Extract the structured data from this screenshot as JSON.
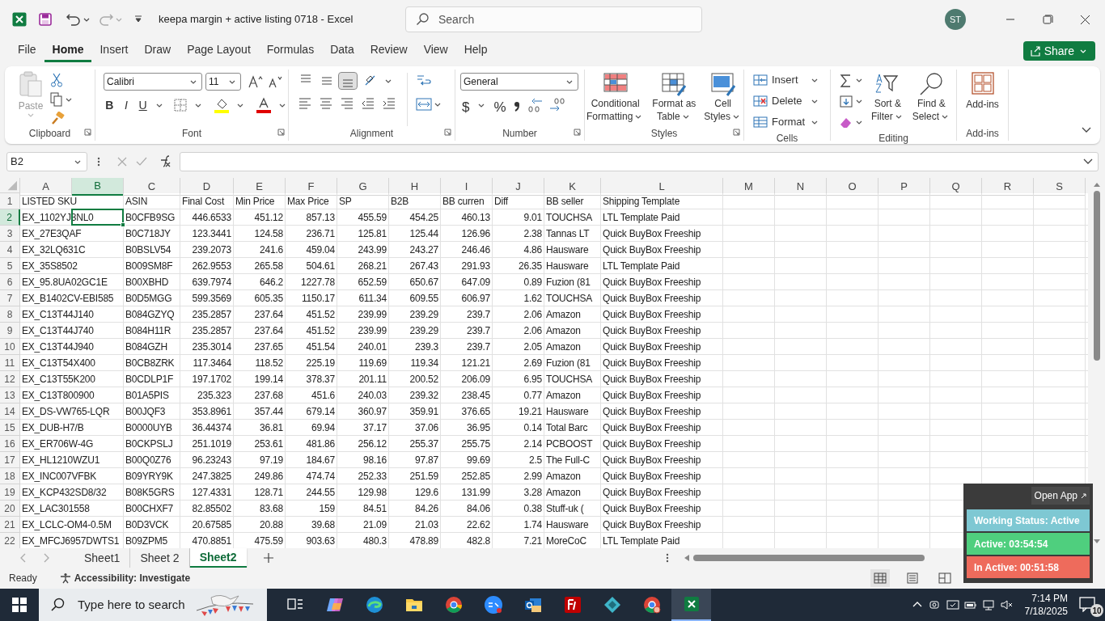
{
  "window": {
    "title": "keepa margin + active listing 0718  -  Excel",
    "search_placeholder": "Search",
    "avatar": "ST"
  },
  "menu_tabs": [
    {
      "label": "File",
      "selected": false
    },
    {
      "label": "Home",
      "selected": true
    },
    {
      "label": "Insert",
      "selected": false
    },
    {
      "label": "Draw",
      "selected": false
    },
    {
      "label": "Page Layout",
      "selected": false
    },
    {
      "label": "Formulas",
      "selected": false
    },
    {
      "label": "Data",
      "selected": false
    },
    {
      "label": "Review",
      "selected": false
    },
    {
      "label": "View",
      "selected": false
    },
    {
      "label": "Help",
      "selected": false
    }
  ],
  "share": "Share",
  "ribbon": {
    "clipboard": {
      "paste": "Paste",
      "label": "Clipboard"
    },
    "font": {
      "name": "Calibri",
      "size": "11",
      "styles": [
        "B",
        "I",
        "U"
      ],
      "label": "Font"
    },
    "alignment": {
      "vertical": [
        {
          "selected": false
        },
        {
          "selected": false
        },
        {
          "selected": true
        }
      ],
      "label": "Alignment"
    },
    "number": {
      "format": "General",
      "symbols": [
        "$",
        "%"
      ],
      "label": "Number"
    },
    "styles": {
      "buttons": [
        {
          "lines": [
            "Conditional",
            "Formatting"
          ]
        },
        {
          "lines": [
            "Format as",
            "Table"
          ]
        },
        {
          "lines": [
            "Cell",
            "Styles"
          ]
        }
      ],
      "label": "Styles"
    },
    "cells": {
      "buttons": [
        "Insert",
        "Delete",
        "Format"
      ],
      "label": "Cells"
    },
    "editing": {
      "buttons": [
        {
          "lines": [
            "Sort &",
            "Filter"
          ]
        },
        {
          "lines": [
            "Find &",
            "Select"
          ]
        }
      ],
      "label": "Editing"
    },
    "addins": {
      "button": "Add-ins",
      "label": "Add-ins"
    }
  },
  "name_box": "B2",
  "sheet": {
    "columns": [
      {
        "label": "A",
        "kind": "text",
        "selected": false
      },
      {
        "label": "B",
        "selected": true
      },
      {
        "label": "C",
        "kind": "text",
        "selected": false
      },
      {
        "label": "D",
        "kind": "number",
        "selected": false
      },
      {
        "label": "E",
        "kind": "number",
        "selected": false
      },
      {
        "label": "F",
        "kind": "number",
        "selected": false
      },
      {
        "label": "G",
        "kind": "number",
        "selected": false
      },
      {
        "label": "H",
        "kind": "number",
        "selected": false
      },
      {
        "label": "I",
        "kind": "number",
        "selected": false
      },
      {
        "label": "J",
        "kind": "number",
        "selected": false
      },
      {
        "label": "K",
        "kind": "text",
        "selected": false
      },
      {
        "label": "L",
        "kind": "text",
        "selected": false
      },
      {
        "label": "M",
        "selected": false
      },
      {
        "label": "N",
        "selected": false
      },
      {
        "label": "O",
        "selected": false
      },
      {
        "label": "P",
        "selected": false
      },
      {
        "label": "Q",
        "selected": false
      },
      {
        "label": "R",
        "selected": false
      },
      {
        "label": "S",
        "selected": false
      }
    ],
    "rows": [
      {
        "number": "1",
        "kind": "header",
        "selected": false,
        "cells": [
          "LISTED SKU",
          null,
          "ASIN",
          "Final Cost",
          "Min Price",
          "Max Price",
          "SP",
          "B2B",
          "BB curren",
          "Diff",
          "BB seller",
          "Shipping Template"
        ]
      },
      {
        "number": "2",
        "kind": "data",
        "selected": true,
        "cells": [
          "EX_1102YJ3NL0",
          null,
          "B0CFB9SG",
          "446.6533",
          "451.12",
          "857.13",
          "455.59",
          "454.25",
          "460.13",
          "9.01",
          "TOUCHSA",
          "LTL Template Paid"
        ]
      },
      {
        "number": "3",
        "kind": "data",
        "selected": false,
        "cells": [
          "EX_27E3QAF",
          null,
          "B0C718JY",
          "123.3441",
          "124.58",
          "236.71",
          "125.81",
          "125.44",
          "126.96",
          "2.38",
          "Tannas LT",
          "Quick BuyBox Freeship"
        ]
      },
      {
        "number": "4",
        "kind": "data",
        "selected": false,
        "cells": [
          "EX_32LQ631C",
          null,
          "B0BSLV54",
          "239.2073",
          "241.6",
          "459.04",
          "243.99",
          "243.27",
          "246.46",
          "4.86",
          "Hausware",
          "Quick BuyBox Freeship"
        ]
      },
      {
        "number": "5",
        "kind": "data",
        "selected": false,
        "cells": [
          "EX_35S8502",
          null,
          "B009SM8F",
          "262.9553",
          "265.58",
          "504.61",
          "268.21",
          "267.43",
          "291.93",
          "26.35",
          "Hausware",
          "LTL Template Paid"
        ]
      },
      {
        "number": "6",
        "kind": "data",
        "selected": false,
        "cells": [
          "EX_95.8UA02GC1E",
          null,
          "B00XBHD",
          "639.7974",
          "646.2",
          "1227.78",
          "652.59",
          "650.67",
          "647.09",
          "0.89",
          "Fuzion (81",
          "Quick BuyBox Freeship"
        ]
      },
      {
        "number": "7",
        "kind": "data",
        "selected": false,
        "cells": [
          "EX_B1402CV-EBI585",
          null,
          "B0D5MGG",
          "599.3569",
          "605.35",
          "1150.17",
          "611.34",
          "609.55",
          "606.97",
          "1.62",
          "TOUCHSA",
          "Quick BuyBox Freeship"
        ]
      },
      {
        "number": "8",
        "kind": "data",
        "selected": false,
        "cells": [
          "EX_C13T44J140",
          null,
          "B084GZYQ",
          "235.2857",
          "237.64",
          "451.52",
          "239.99",
          "239.29",
          "239.7",
          "2.06",
          "Amazon",
          "Quick BuyBox Freeship"
        ]
      },
      {
        "number": "9",
        "kind": "data",
        "selected": false,
        "cells": [
          "EX_C13T44J740",
          null,
          "B084H11R",
          "235.2857",
          "237.64",
          "451.52",
          "239.99",
          "239.29",
          "239.7",
          "2.06",
          "Amazon",
          "Quick BuyBox Freeship"
        ]
      },
      {
        "number": "10",
        "kind": "data",
        "selected": false,
        "cells": [
          "EX_C13T44J940",
          null,
          "B084GZH",
          "235.3014",
          "237.65",
          "451.54",
          "240.01",
          "239.3",
          "239.7",
          "2.05",
          "Amazon",
          "Quick BuyBox Freeship"
        ]
      },
      {
        "number": "11",
        "kind": "data",
        "selected": false,
        "cells": [
          "EX_C13T54X400",
          null,
          "B0CB8ZRK",
          "117.3464",
          "118.52",
          "225.19",
          "119.69",
          "119.34",
          "121.21",
          "2.69",
          "Fuzion (81",
          "Quick BuyBox Freeship"
        ]
      },
      {
        "number": "12",
        "kind": "data",
        "selected": false,
        "cells": [
          "EX_C13T55K200",
          null,
          "B0CDLP1F",
          "197.1702",
          "199.14",
          "378.37",
          "201.11",
          "200.52",
          "206.09",
          "6.95",
          "TOUCHSA",
          "Quick BuyBox Freeship"
        ]
      },
      {
        "number": "13",
        "kind": "data",
        "selected": false,
        "cells": [
          "EX_C13T800900",
          null,
          "B01A5PIS",
          "235.323",
          "237.68",
          "451.6",
          "240.03",
          "239.32",
          "238.45",
          "0.77",
          "Amazon",
          "Quick BuyBox Freeship"
        ]
      },
      {
        "number": "14",
        "kind": "data",
        "selected": false,
        "cells": [
          "EX_DS-VW765-LQR",
          null,
          "B00JQF3",
          "353.8961",
          "357.44",
          "679.14",
          "360.97",
          "359.91",
          "376.65",
          "19.21",
          "Hausware",
          "Quick BuyBox Freeship"
        ]
      },
      {
        "number": "15",
        "kind": "data",
        "selected": false,
        "cells": [
          "EX_DUB-H7/B",
          null,
          "B0000UYB",
          "36.44374",
          "36.81",
          "69.94",
          "37.17",
          "37.06",
          "36.95",
          "0.14",
          "Total Barc",
          "Quick BuyBox Freeship"
        ]
      },
      {
        "number": "16",
        "kind": "data",
        "selected": false,
        "cells": [
          "EX_ER706W-4G",
          null,
          "B0CKPSLJ",
          "251.1019",
          "253.61",
          "481.86",
          "256.12",
          "255.37",
          "255.75",
          "2.14",
          "PCBOOST",
          "Quick BuyBox Freeship"
        ]
      },
      {
        "number": "17",
        "kind": "data",
        "selected": false,
        "cells": [
          "EX_HL1210WZU1",
          null,
          "B00Q0Z76",
          "96.23243",
          "97.19",
          "184.67",
          "98.16",
          "97.87",
          "99.69",
          "2.5",
          "The Full-C",
          "Quick BuyBox Freeship"
        ]
      },
      {
        "number": "18",
        "kind": "data",
        "selected": false,
        "cells": [
          "EX_INC007VFBK",
          null,
          "B09YRY9K",
          "247.3825",
          "249.86",
          "474.74",
          "252.33",
          "251.59",
          "252.85",
          "2.99",
          "Amazon",
          "Quick BuyBox Freeship"
        ]
      },
      {
        "number": "19",
        "kind": "data",
        "selected": false,
        "cells": [
          "EX_KCP432SD8/32",
          null,
          "B08K5GRS",
          "127.4331",
          "128.71",
          "244.55",
          "129.98",
          "129.6",
          "131.99",
          "3.28",
          "Amazon",
          "Quick BuyBox Freeship"
        ]
      },
      {
        "number": "20",
        "kind": "data",
        "selected": false,
        "cells": [
          "EX_LAC301558",
          null,
          "B00CHXF7",
          "82.85502",
          "83.68",
          "159",
          "84.51",
          "84.26",
          "84.06",
          "0.38",
          "Stuff-uk (",
          "Quick BuyBox Freeship"
        ]
      },
      {
        "number": "21",
        "kind": "data",
        "selected": false,
        "cells": [
          "EX_LCLC-OM4-0.5M",
          null,
          "B0D3VCK",
          "20.67585",
          "20.88",
          "39.68",
          "21.09",
          "21.03",
          "22.62",
          "1.74",
          "Hausware",
          "Quick BuyBox Freeship"
        ]
      },
      {
        "number": "22",
        "kind": "data",
        "selected": false,
        "cells": [
          "EX_MFCJ6957DWTS1",
          null,
          "B09ZPM5",
          "470.8851",
          "475.59",
          "903.63",
          "480.3",
          "478.89",
          "482.8",
          "7.21",
          "MoreCoC",
          "LTL Template Paid"
        ]
      }
    ]
  },
  "sheet_tabs": [
    {
      "label": "Sheet1",
      "selected": false
    },
    {
      "label": "Sheet 2",
      "selected": false
    },
    {
      "label": "Sheet2",
      "selected": true
    }
  ],
  "status_bar": {
    "mode": "Ready",
    "accessibility": "Accessibility: Investigate"
  },
  "widget": {
    "open_app": "Open App",
    "bars": [
      {
        "text": "Working Status: Active",
        "color": "#7ec8d3"
      },
      {
        "text": "Active: 03:54:54",
        "color": "#4fcf7e"
      },
      {
        "text": "In Active: 00:51:58",
        "color": "#ee6b5c"
      }
    ]
  },
  "taskbar": {
    "search_placeholder": "Type here to search",
    "time": "7:14 PM",
    "date": "7/18/2025",
    "notifications": "10"
  }
}
